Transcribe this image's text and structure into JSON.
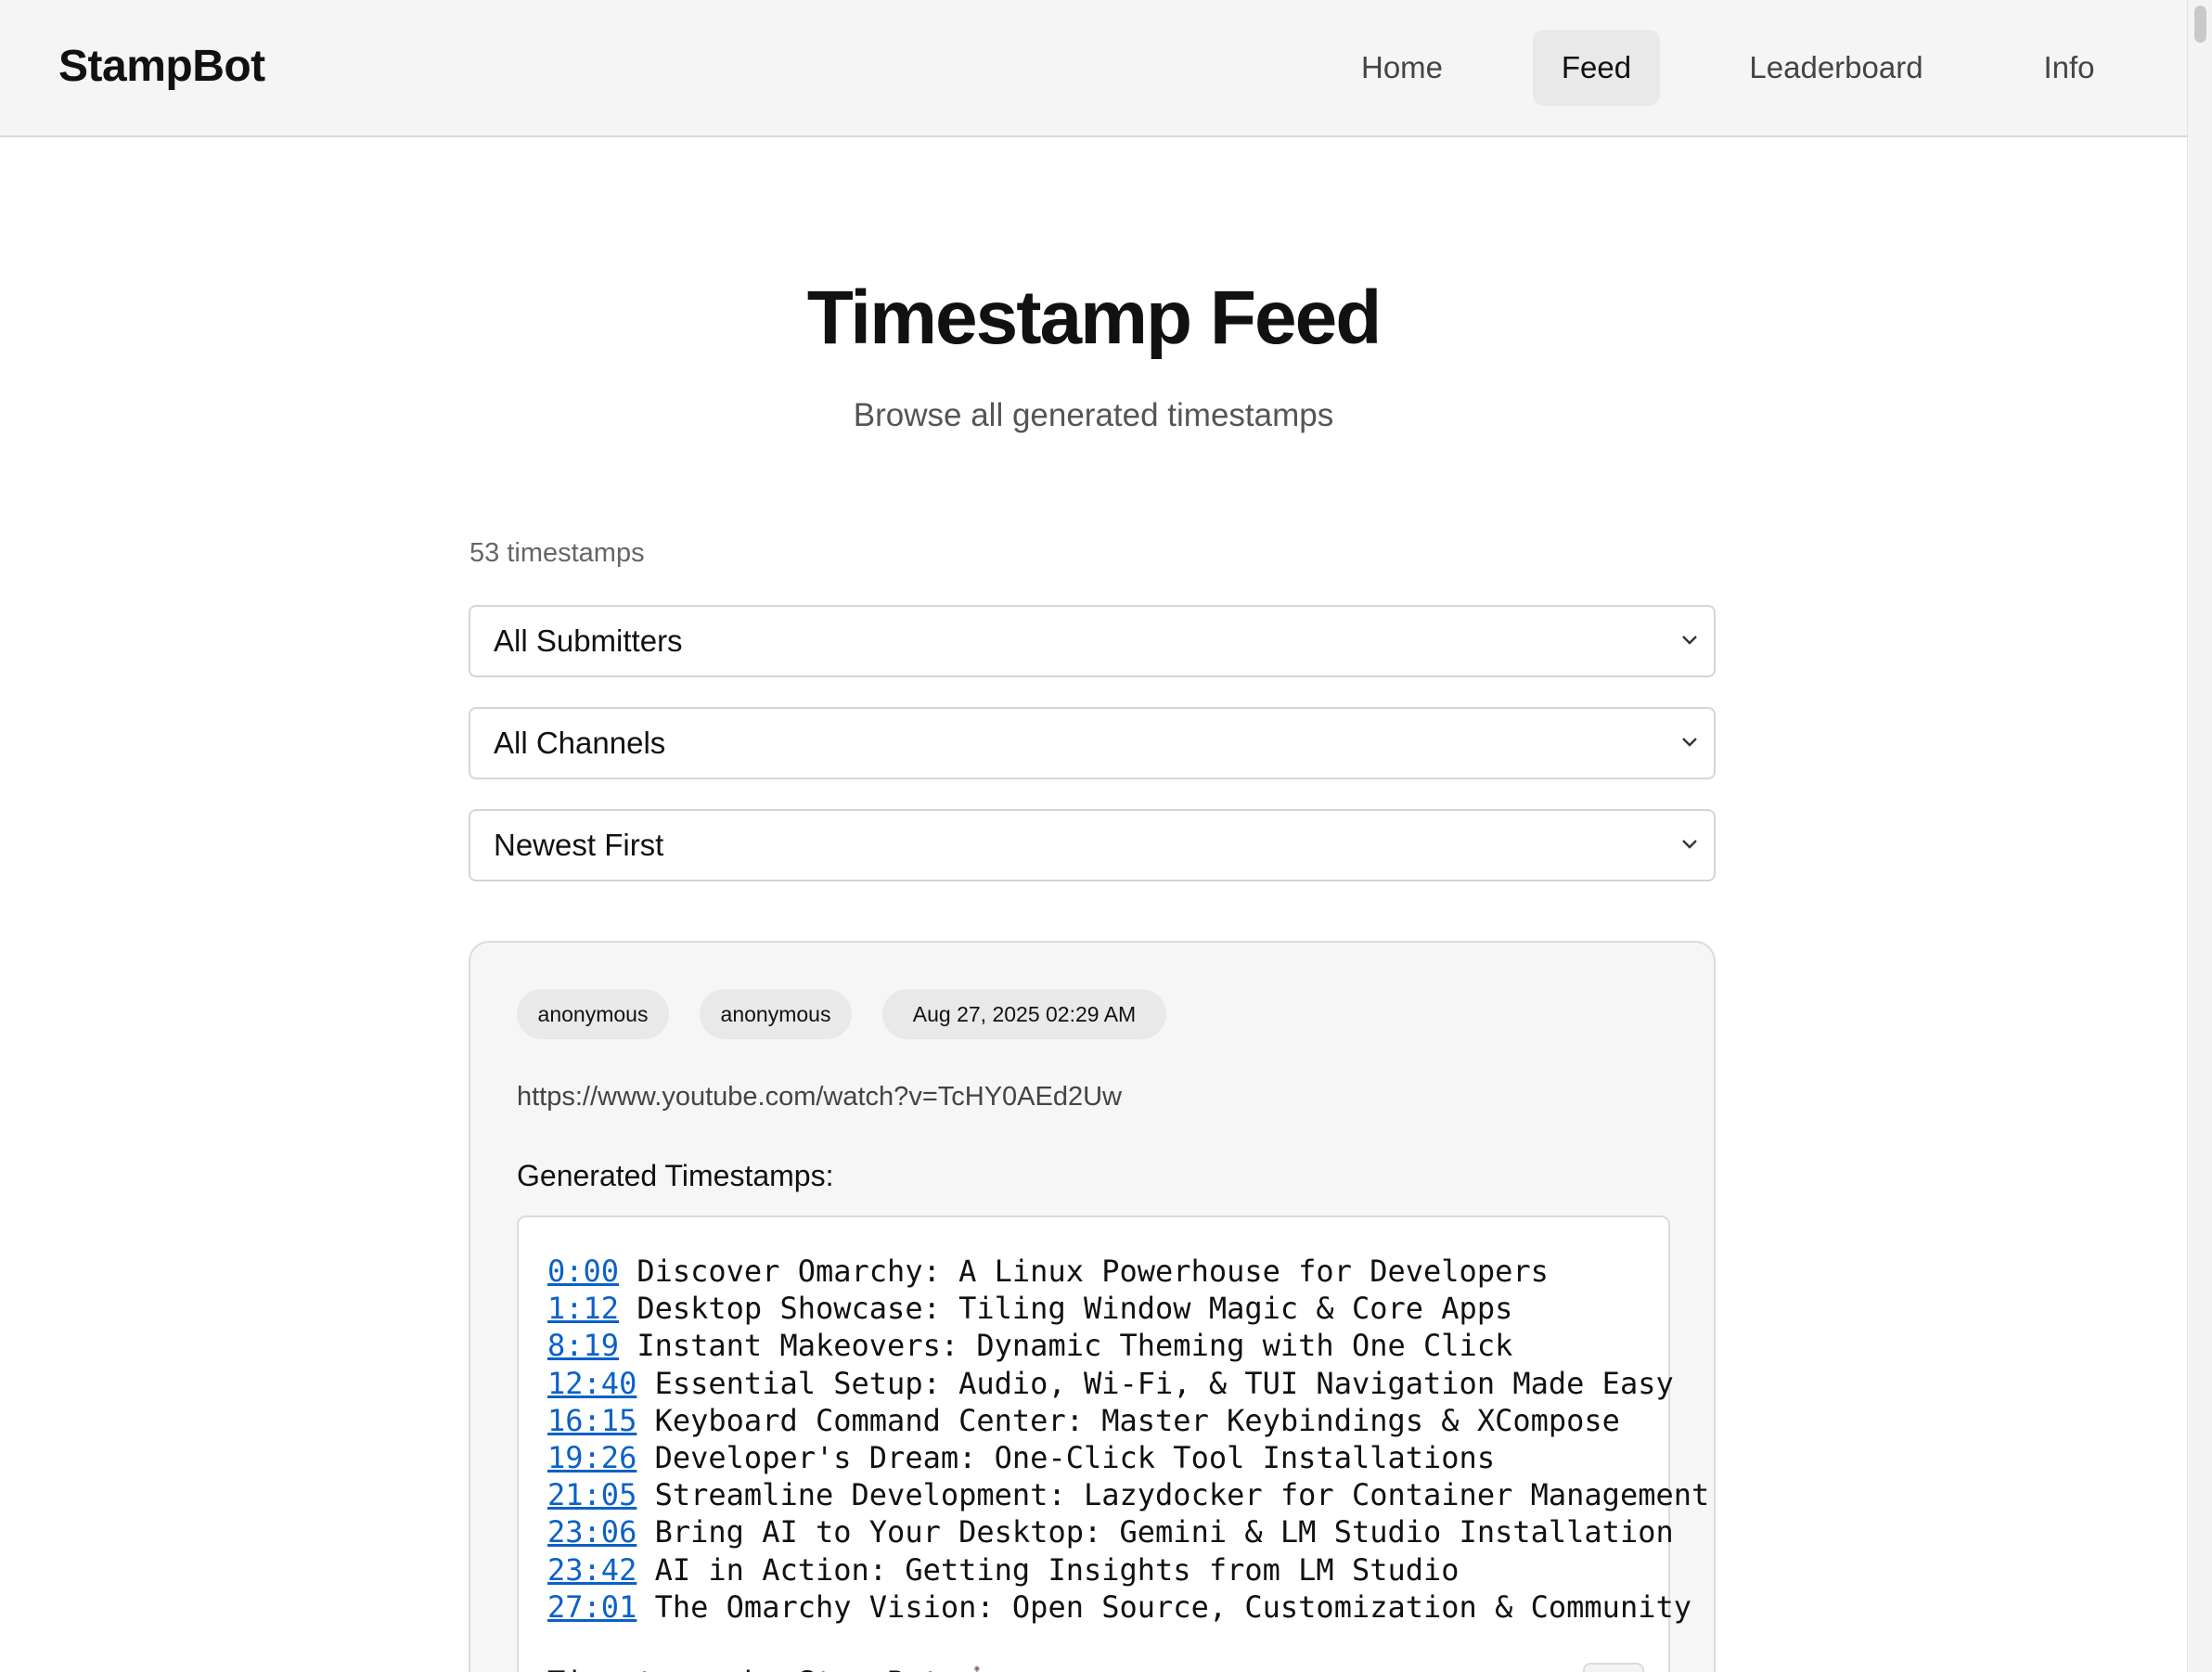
{
  "brand": "StampBot",
  "nav": {
    "home": "Home",
    "feed": "Feed",
    "leaderboard": "Leaderboard",
    "info": "Info",
    "active": "Feed"
  },
  "hero": {
    "title": "Timestamp Feed",
    "subtitle": "Browse all generated timestamps"
  },
  "count_text": "53 timestamps",
  "filters": {
    "submitters": "All Submitters",
    "channels": "All Channels",
    "sort": "Newest First"
  },
  "entries": [
    {
      "submitter": "anonymous",
      "channel": "anonymous",
      "date": "Aug 27, 2025 02:29 AM",
      "url": "https://www.youtube.com/watch?v=TcHY0AEd2Uw",
      "heading": "Generated Timestamps:",
      "timestamps": [
        {
          "time": "0:00",
          "title": "Discover Omarchy: A Linux Powerhouse for Developers"
        },
        {
          "time": "1:12",
          "title": "Desktop Showcase: Tiling Window Magic & Core Apps"
        },
        {
          "time": "8:19",
          "title": "Instant Makeovers: Dynamic Theming with One Click"
        },
        {
          "time": "12:40",
          "title": "Essential Setup: Audio, Wi-Fi, & TUI Navigation Made Easy"
        },
        {
          "time": "16:15",
          "title": "Keyboard Command Center: Master Keybindings & XCompose"
        },
        {
          "time": "19:26",
          "title": "Developer's Dream: One-Click Tool Installations"
        },
        {
          "time": "21:05",
          "title": "Streamline Development: Lazydocker for Container Management"
        },
        {
          "time": "23:06",
          "title": "Bring AI to Your Desktop: Gemini & LM Studio Installation"
        },
        {
          "time": "23:42",
          "title": "AI in Action: Getting Insights from LM Studio"
        },
        {
          "time": "27:01",
          "title": "The Omarchy Vision: Open Source, Customization & Community"
        }
      ],
      "footer": "Timestamps by StampBot 🤖"
    }
  ],
  "icons": {
    "select_chevron": "chevron-down-icon",
    "copy": "copy-icon"
  },
  "colors": {
    "link": "#0b61c7",
    "nav_active_bg": "#e9e9e9"
  }
}
